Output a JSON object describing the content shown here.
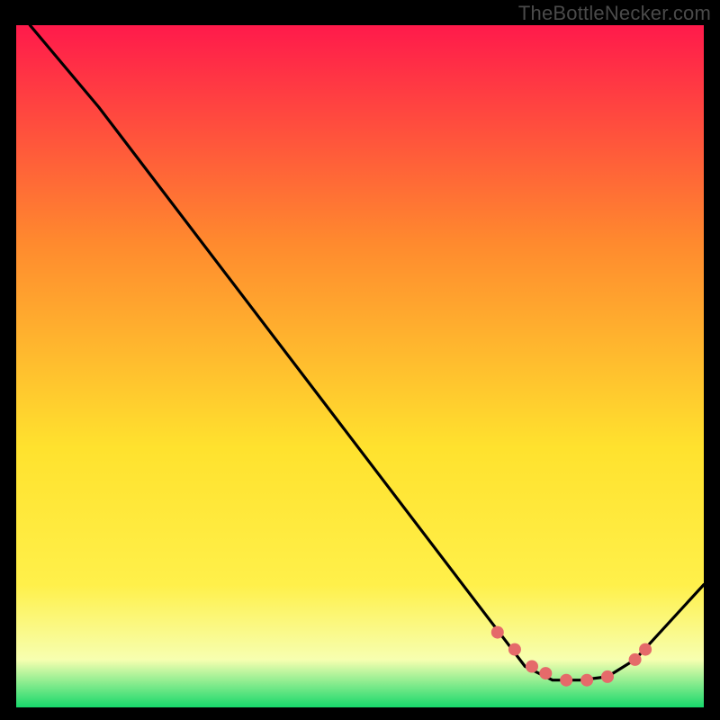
{
  "attribution": "TheBottleNecker.com",
  "colors": {
    "gradient_top": "#ff1a4b",
    "gradient_mid_upper": "#ff8a2e",
    "gradient_mid": "#ffe22e",
    "gradient_mid_lower": "#fff04a",
    "gradient_pale": "#f7ffb0",
    "gradient_bottom": "#17d86b",
    "frame": "#000000",
    "curve": "#000000",
    "marker": "#e56a6a"
  },
  "chart_data": {
    "type": "line",
    "title": "",
    "xlabel": "",
    "ylabel": "",
    "xlim": [
      0,
      100
    ],
    "ylim": [
      0,
      100
    ],
    "series": [
      {
        "name": "curve",
        "x": [
          2,
          12,
          71,
          74,
          78,
          82,
          86,
          90,
          100
        ],
        "y": [
          100,
          88,
          10,
          6,
          4,
          4,
          4.5,
          7,
          18
        ]
      },
      {
        "name": "markers",
        "x": [
          70,
          72.5,
          75,
          77,
          80,
          83,
          86,
          90,
          91.5
        ],
        "y": [
          11,
          8.5,
          6,
          5,
          4,
          4,
          4.5,
          7,
          8.5
        ]
      }
    ]
  }
}
